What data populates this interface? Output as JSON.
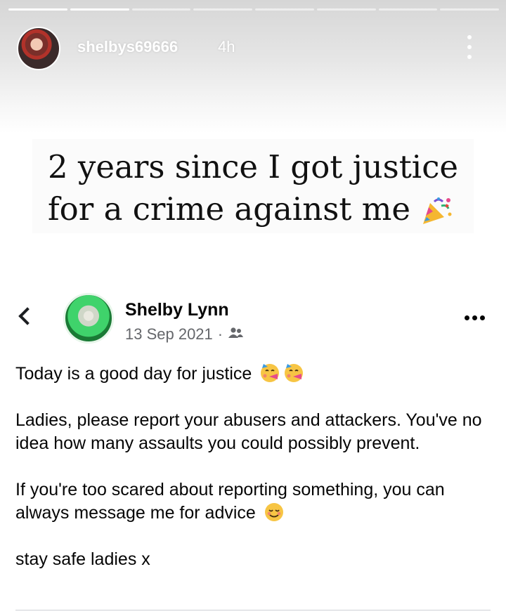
{
  "story": {
    "username": "shelbys69666",
    "time_ago": "4h",
    "progress_segments": 8,
    "progress_done": 2,
    "caption_line1": "2 years since I got justice",
    "caption_line2": "for a crime against me",
    "caption_emoji": "party-popper"
  },
  "post": {
    "author": "Shelby Lynn",
    "date": "13 Sep 2021",
    "separator": "·",
    "audience_icon": "friends-icon",
    "paragraphs": [
      {
        "text": "Today is a good day for justice",
        "emoji": [
          "face-with-party-horn",
          "face-with-party-horn"
        ]
      },
      {
        "text": "Ladies, please report your abusers and attackers. You've no idea how many assaults you could possibly prevent.",
        "emoji": []
      },
      {
        "text": "If you're too scared about reporting something, you can always message me for advice",
        "emoji": [
          "smiling-face"
        ]
      },
      {
        "text": "stay safe ladies x",
        "emoji": []
      }
    ]
  },
  "colors": {
    "meta_text": "#65676b",
    "body_text": "#050505",
    "divider": "#ced0d4"
  }
}
